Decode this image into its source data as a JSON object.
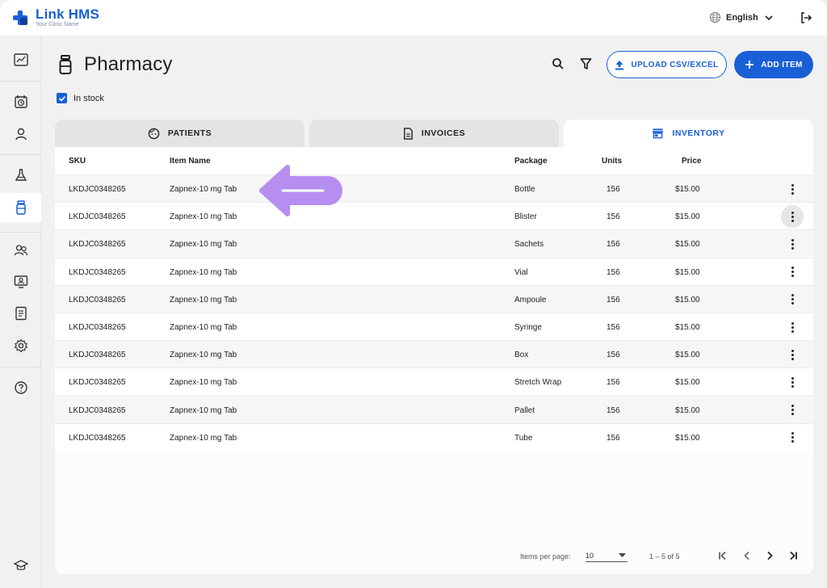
{
  "app": {
    "name": "Link HMS",
    "subtitle": "Your Clinic Name"
  },
  "topbar": {
    "language": "English"
  },
  "page": {
    "title": "Pharmacy",
    "upload_label": "UPLOAD CSV/EXCEL",
    "add_label": "ADD ITEM",
    "in_stock_label": "In stock",
    "in_stock_checked": true
  },
  "tabs": [
    {
      "label": "PATIENTS",
      "icon": "face-icon",
      "active": false
    },
    {
      "label": "INVOICES",
      "icon": "document-icon",
      "active": false
    },
    {
      "label": "INVENTORY",
      "icon": "store-icon",
      "active": true
    }
  ],
  "table": {
    "columns": {
      "sku": "SKU",
      "item": "Item Name",
      "package": "Package",
      "units": "Units",
      "price": "Price"
    },
    "rows": [
      {
        "sku": "LKDJC0348265",
        "item": "Zapnex-10 mg Tab",
        "package": "Bottle",
        "units": "156",
        "price": "$15.00"
      },
      {
        "sku": "LKDJC0348265",
        "item": "Zapnex-10 mg Tab",
        "package": "Blister",
        "units": "156",
        "price": "$15.00"
      },
      {
        "sku": "LKDJC0348265",
        "item": "Zapnex-10 mg Tab",
        "package": "Sachets",
        "units": "156",
        "price": "$15.00"
      },
      {
        "sku": "LKDJC0348265",
        "item": "Zapnex-10 mg Tab",
        "package": "Vial",
        "units": "156",
        "price": "$15.00"
      },
      {
        "sku": "LKDJC0348265",
        "item": "Zapnex-10 mg Tab",
        "package": "Ampoule",
        "units": "156",
        "price": "$15.00"
      },
      {
        "sku": "LKDJC0348265",
        "item": "Zapnex-10 mg Tab",
        "package": "Syringe",
        "units": "156",
        "price": "$15.00"
      },
      {
        "sku": "LKDJC0348265",
        "item": "Zapnex-10 mg Tab",
        "package": "Box",
        "units": "156",
        "price": "$15.00"
      },
      {
        "sku": "LKDJC0348265",
        "item": "Zapnex-10 mg Tab",
        "package": "Stretch Wrap",
        "units": "156",
        "price": "$15.00"
      },
      {
        "sku": "LKDJC0348265",
        "item": "Zapnex-10 mg Tab",
        "package": "Pallet",
        "units": "156",
        "price": "$15.00"
      },
      {
        "sku": "LKDJC0348265",
        "item": "Zapnex-10 mg Tab",
        "package": "Tube",
        "units": "156",
        "price": "$15.00"
      }
    ]
  },
  "pagination": {
    "items_per_page_label": "Items per page:",
    "items_per_page": "10",
    "range": "1 – 5 of 5"
  },
  "colors": {
    "accent": "#1a5fd6",
    "annotation_arrow": "#b58ef0"
  }
}
